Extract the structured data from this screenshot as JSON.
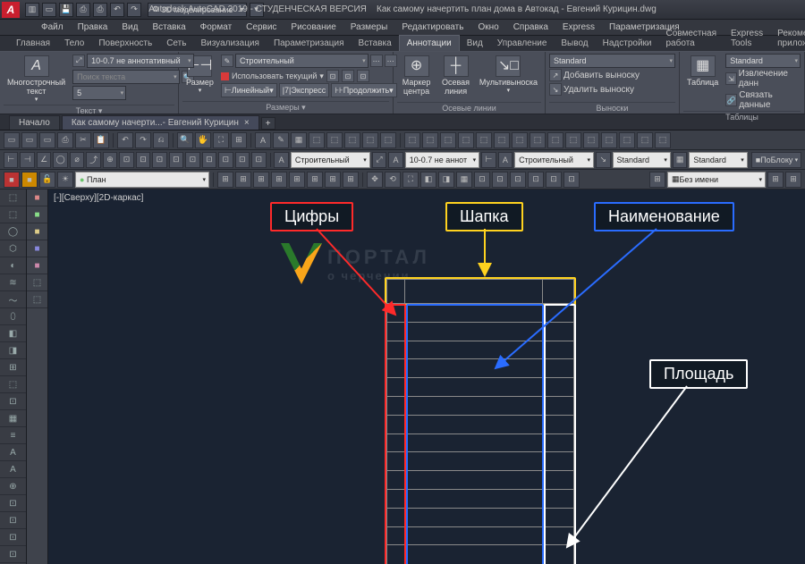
{
  "title": {
    "app": "Autodesk AutoCAD 2019 - СТУДЕНЧЕСКАЯ ВЕРСИЯ",
    "doc": "Как самому начертить план дома в Автокад - Евгений Курицин.dwg"
  },
  "workspace_dropdown": "3D моделирование",
  "menu": [
    "Файл",
    "Правка",
    "Вид",
    "Вставка",
    "Формат",
    "Сервис",
    "Рисование",
    "Размеры",
    "Редактировать",
    "Окно",
    "Справка",
    "Express",
    "Параметризация"
  ],
  "ribbon_tabs": [
    "Главная",
    "Тело",
    "Поверхность",
    "Сеть",
    "Визуализация",
    "Параметризация",
    "Вставка",
    "Аннотации",
    "Вид",
    "Управление",
    "Вывод",
    "Надстройки",
    "Совместная работа",
    "Express Tools",
    "Рекомендованные приложения"
  ],
  "ribbon_active_index": 7,
  "ribbon": {
    "text_panel": {
      "btn": "Многострочный\nтекст",
      "icon": "A",
      "style_combo": "10-0.7 не аннотативный",
      "search_placeholder": "Поиск текста",
      "height_combo": "5",
      "title": "Текст ▾"
    },
    "dim_panel": {
      "btn": "Размер",
      "style_combo": "Строительный",
      "use_current": "Использовать текущий",
      "sub_btns": [
        "Линейный",
        "Экспресс",
        "Продолжить"
      ],
      "title": "Размеры ▾"
    },
    "leaders_panel": {
      "items": [
        "Маркер центра",
        "Осевая линия",
        "Мультивыноска"
      ],
      "title": "Осевые линии"
    },
    "callouts_panel": {
      "style": "Standard",
      "rows": [
        "Добавить выноску",
        "Удалить выноску"
      ],
      "title": "Выноски"
    },
    "table_panel": {
      "btn": "Таблица",
      "style": "Standard",
      "rows": [
        "Извлечение данн",
        "Связать данные"
      ],
      "title": "Таблицы"
    }
  },
  "filetabs": {
    "start": "Начало",
    "active": "Как самому начерти...- Евгений Курицин"
  },
  "toolbars": {
    "row2_combos": {
      "dimstyle": "Строительный",
      "textstyle": "10-0.7 не аннот",
      "dimstyle2": "Строительный",
      "std1": "Standard",
      "std2": "Standard",
      "byblock": "ПоБлоку"
    },
    "row3": {
      "layer": "План",
      "noname": "Без имени"
    }
  },
  "viewport_label": "[-][Сверху][2D-каркас]",
  "callouts": {
    "digits": "Цифры",
    "header": "Шапка",
    "name": "Наименование",
    "area": "Площадь"
  },
  "watermark": {
    "line1": "ПОРТАЛ",
    "line2": "о черчении"
  }
}
